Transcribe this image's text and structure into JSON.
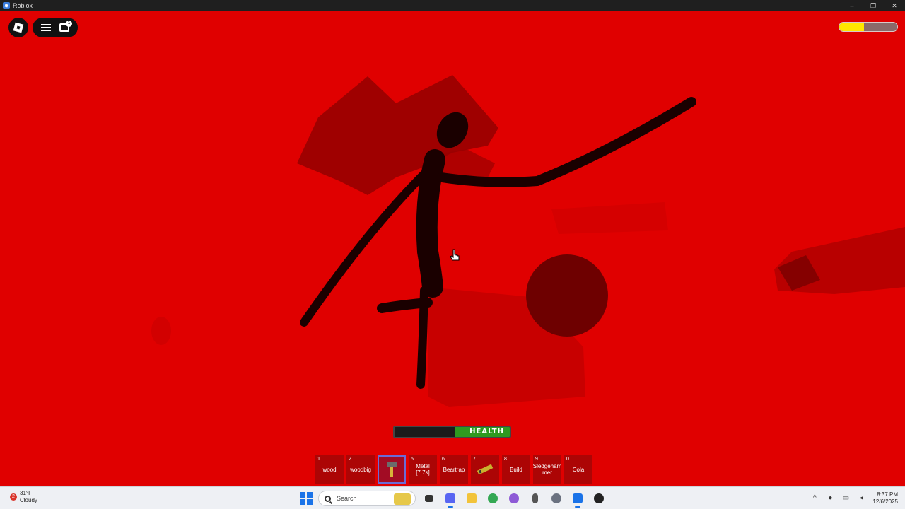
{
  "window": {
    "title": "Roblox",
    "minimize": "–",
    "restore": "❐",
    "close": "✕"
  },
  "hud": {
    "chat_badge": "1",
    "stamina_level": 0.43,
    "health_label": "HEALTH",
    "health_level": 0.48
  },
  "hotbar": [
    {
      "num": "1",
      "label": "wood"
    },
    {
      "num": "2",
      "label": "woodbig"
    },
    {
      "num": "",
      "label": "",
      "icon": "hammer-icon",
      "selected": true
    },
    {
      "num": "5",
      "label": "Metal [7.7s]"
    },
    {
      "num": "6",
      "label": "Beartrap"
    },
    {
      "num": "7",
      "label": "",
      "icon": "drill-icon"
    },
    {
      "num": "8",
      "label": "Build"
    },
    {
      "num": "9",
      "label": "Sledgeham mer"
    },
    {
      "num": "0",
      "label": "Cola"
    }
  ],
  "taskbar": {
    "weather_badge": "2",
    "temperature": "31°F",
    "condition": "Cloudy",
    "search_placeholder": "Search",
    "time": "8:37 PM",
    "date": "12/6/2025"
  },
  "colors": {
    "scene_red": "#e00000",
    "stamina": "#ffe600",
    "health": "#2e9a20",
    "selected_slot_border": "#6b6bd6"
  }
}
